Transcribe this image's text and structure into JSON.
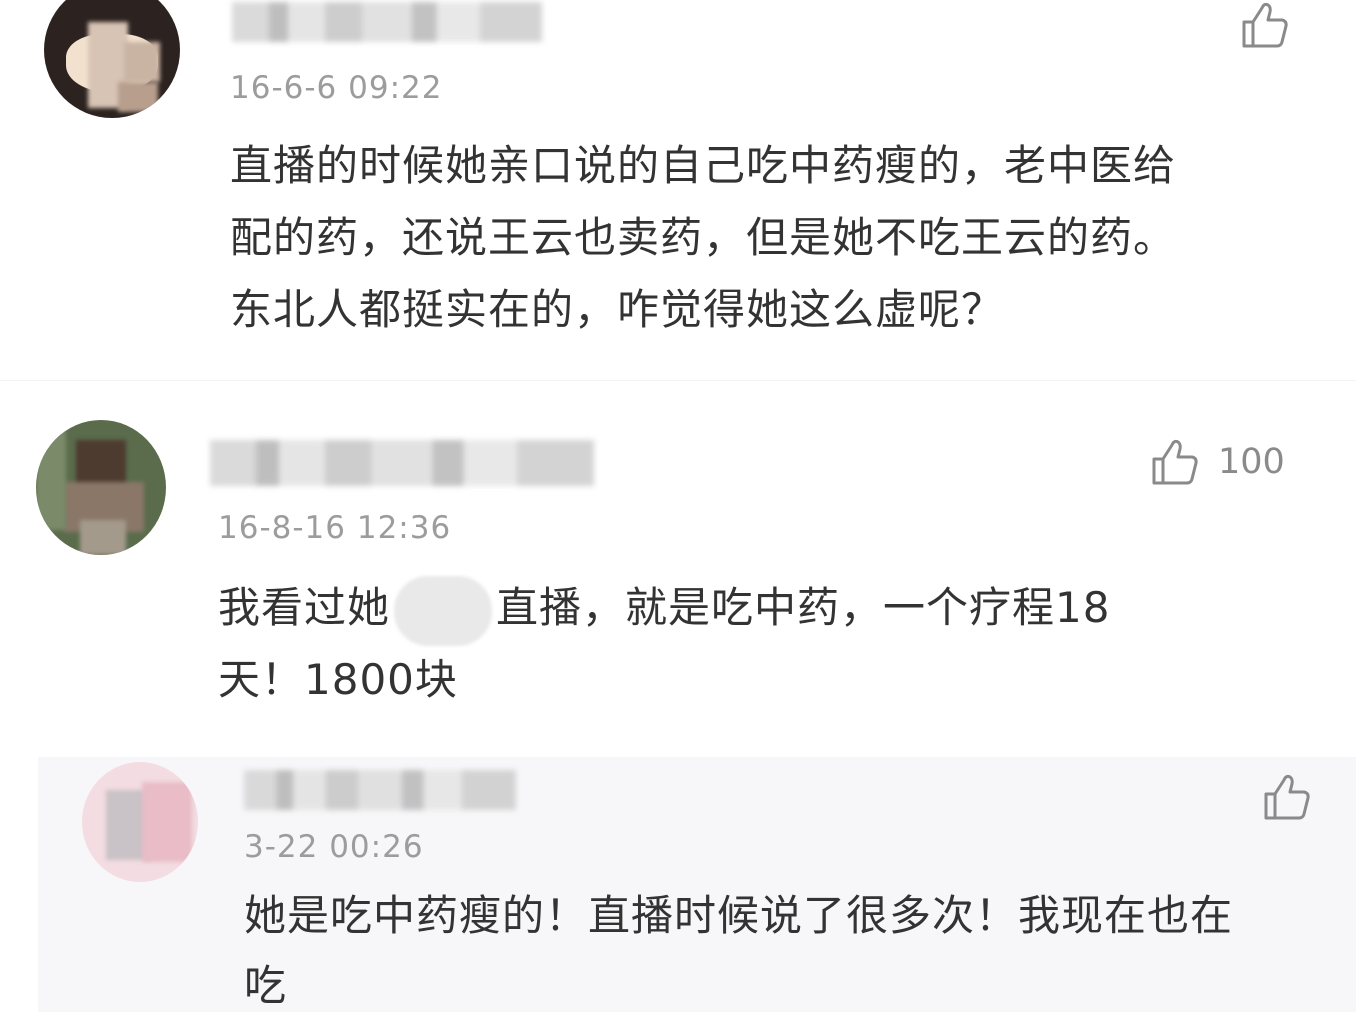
{
  "comments": [
    {
      "timestamp": "16-6-6 09:22",
      "text_lines": [
        "直播的时候她亲口说的自己吃中药瘦的，老中医给",
        "配的药，还说王云也卖药，但是她不吃王云的药。",
        "东北人都挺实在的，咋觉得她这么虚呢？"
      ],
      "like_icon": "thumbs-up-icon",
      "like_count": ""
    },
    {
      "timestamp": "16-8-16 12:36",
      "text_line1_before": "我看过她",
      "text_line1_after": "直播，就是吃中药，一个疗程18",
      "text_line2": "天！1800块",
      "like_icon": "thumbs-up-icon",
      "like_count": "100"
    },
    {
      "timestamp": "3-22 00:26",
      "text_lines": [
        "她是吃中药瘦的！直播时候说了很多次！我现在也在",
        "吃"
      ],
      "like_icon": "thumbs-up-icon",
      "like_count": ""
    }
  ],
  "colors": {
    "text": "#333333",
    "timestamp": "#9c9c9c",
    "icon": "#8a8a8a",
    "reply_background": "#f7f7f9"
  }
}
